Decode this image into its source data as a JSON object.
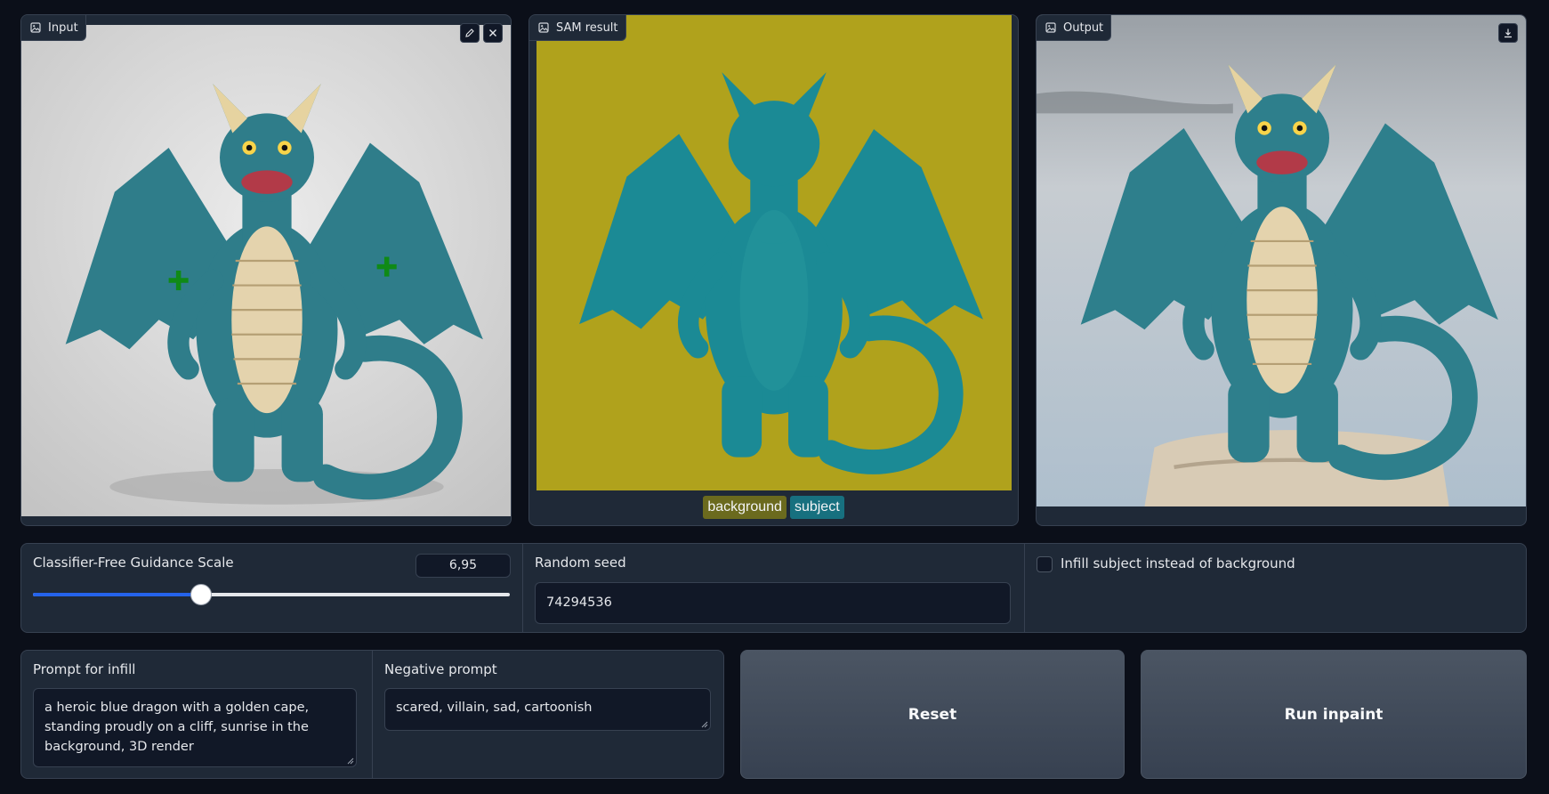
{
  "input_panel": {
    "label": "Input",
    "point_prompts": 2
  },
  "sam_panel": {
    "label": "SAM result",
    "legend": [
      {
        "label": "background",
        "color": "#6b6a1e"
      },
      {
        "label": "subject",
        "color": "#17707f"
      }
    ]
  },
  "output_panel": {
    "label": "Output"
  },
  "cfg": {
    "label": "Classifier-Free Guidance Scale",
    "value": "6,95",
    "fraction": 0.352
  },
  "seed": {
    "label": "Random seed",
    "value": "74294536"
  },
  "infill_toggle": {
    "label": "Infill subject instead of background",
    "checked": false
  },
  "prompt": {
    "label": "Prompt for infill",
    "value": "a heroic blue dragon with a golden cape, standing proudly on a cliff, sunrise in the background, 3D render"
  },
  "negative_prompt": {
    "label": "Negative prompt",
    "value": "scared, villain, sad, cartoonish"
  },
  "buttons": {
    "reset": "Reset",
    "run": "Run inpaint"
  },
  "colors": {
    "sam_background": "#b0a21c",
    "sam_subject": "#1b8a95",
    "slider_fill": "#2563eb"
  }
}
